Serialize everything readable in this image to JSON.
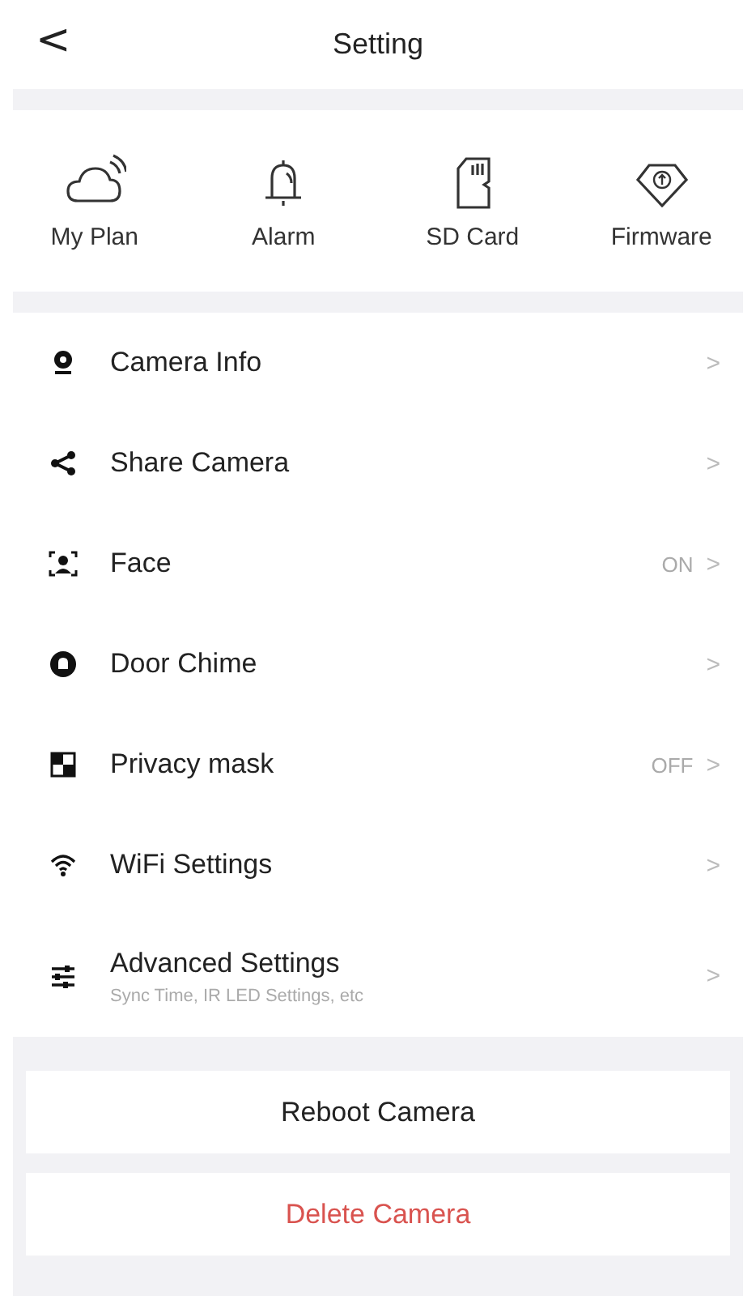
{
  "header": {
    "back": "<",
    "title": "Setting"
  },
  "shortcuts": [
    {
      "label": "My Plan"
    },
    {
      "label": "Alarm"
    },
    {
      "label": "SD Card"
    },
    {
      "label": "Firmware"
    }
  ],
  "menu": [
    {
      "label": "Camera Info",
      "chevron": ">"
    },
    {
      "label": "Share Camera",
      "chevron": ">"
    },
    {
      "label": "Face",
      "value": "ON",
      "chevron": ">"
    },
    {
      "label": "Door Chime",
      "chevron": ">"
    },
    {
      "label": "Privacy mask",
      "value": "OFF",
      "chevron": ">"
    },
    {
      "label": "WiFi Settings",
      "chevron": ">"
    },
    {
      "label": "Advanced  Settings",
      "subtitle": "Sync Time, IR LED Settings, etc",
      "chevron": ">"
    }
  ],
  "actions": [
    {
      "label": "Reboot Camera",
      "kind": "normal"
    },
    {
      "label": "Delete Camera",
      "kind": "danger"
    }
  ]
}
